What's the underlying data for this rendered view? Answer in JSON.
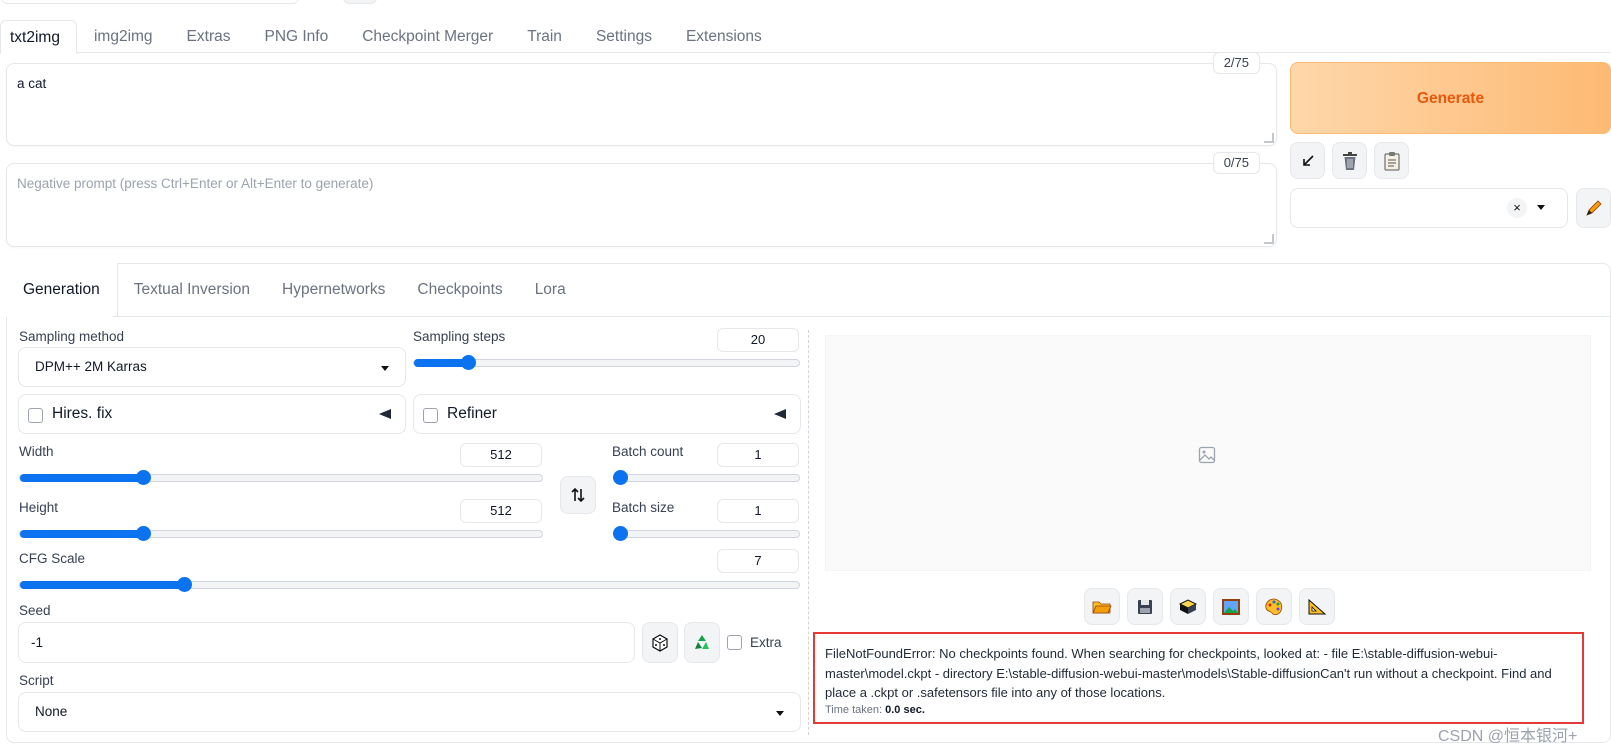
{
  "main_tabs": [
    {
      "label": "txt2img",
      "active": true
    },
    {
      "label": "img2img"
    },
    {
      "label": "Extras"
    },
    {
      "label": "PNG Info"
    },
    {
      "label": "Checkpoint Merger"
    },
    {
      "label": "Train"
    },
    {
      "label": "Settings"
    },
    {
      "label": "Extensions"
    }
  ],
  "prompt": {
    "value": "a cat",
    "token_count": "2/75"
  },
  "negative_prompt": {
    "placeholder": "Negative prompt (press Ctrl+Enter or Alt+Enter to generate)",
    "token_count": "0/75"
  },
  "generate_label": "Generate",
  "colors": {
    "accent": "#0b72f0",
    "generate_text": "#ea580c",
    "error_border": "#e53935"
  },
  "sub_tabs": [
    {
      "label": "Generation",
      "active": true
    },
    {
      "label": "Textual Inversion"
    },
    {
      "label": "Hypernetworks"
    },
    {
      "label": "Checkpoints"
    },
    {
      "label": "Lora"
    }
  ],
  "sampling_method": {
    "label": "Sampling method",
    "value": "DPM++ 2M Karras"
  },
  "sampling_steps": {
    "label": "Sampling steps",
    "value": "20",
    "fraction": 0.14
  },
  "hires_fix": {
    "label": "Hires. fix",
    "checked": false
  },
  "refiner": {
    "label": "Refiner",
    "checked": false
  },
  "width": {
    "label": "Width",
    "value": "512",
    "fraction": 0.235
  },
  "height": {
    "label": "Height",
    "value": "512",
    "fraction": 0.235
  },
  "batch_count": {
    "label": "Batch count",
    "value": "1",
    "fraction": 0.0
  },
  "batch_size": {
    "label": "Batch size",
    "value": "1",
    "fraction": 0.0
  },
  "cfg_scale": {
    "label": "CFG Scale",
    "value": "7",
    "fraction": 0.21
  },
  "seed": {
    "label": "Seed",
    "value": "-1",
    "extra_label": "Extra"
  },
  "script": {
    "label": "Script",
    "value": "None"
  },
  "error": {
    "message": "FileNotFoundError: No checkpoints found. When searching for checkpoints, looked at: - file E:\\stable-diffusion-webui-master\\model.ckpt - directory E:\\stable-diffusion-webui-master\\models\\Stable-diffusionCan't run without a checkpoint. Find and place a .ckpt or .safetensors file into any of those locations.",
    "time_label": "Time taken:",
    "time_value": "0.0 sec."
  },
  "watermark": "CSDN @恒本银河+"
}
